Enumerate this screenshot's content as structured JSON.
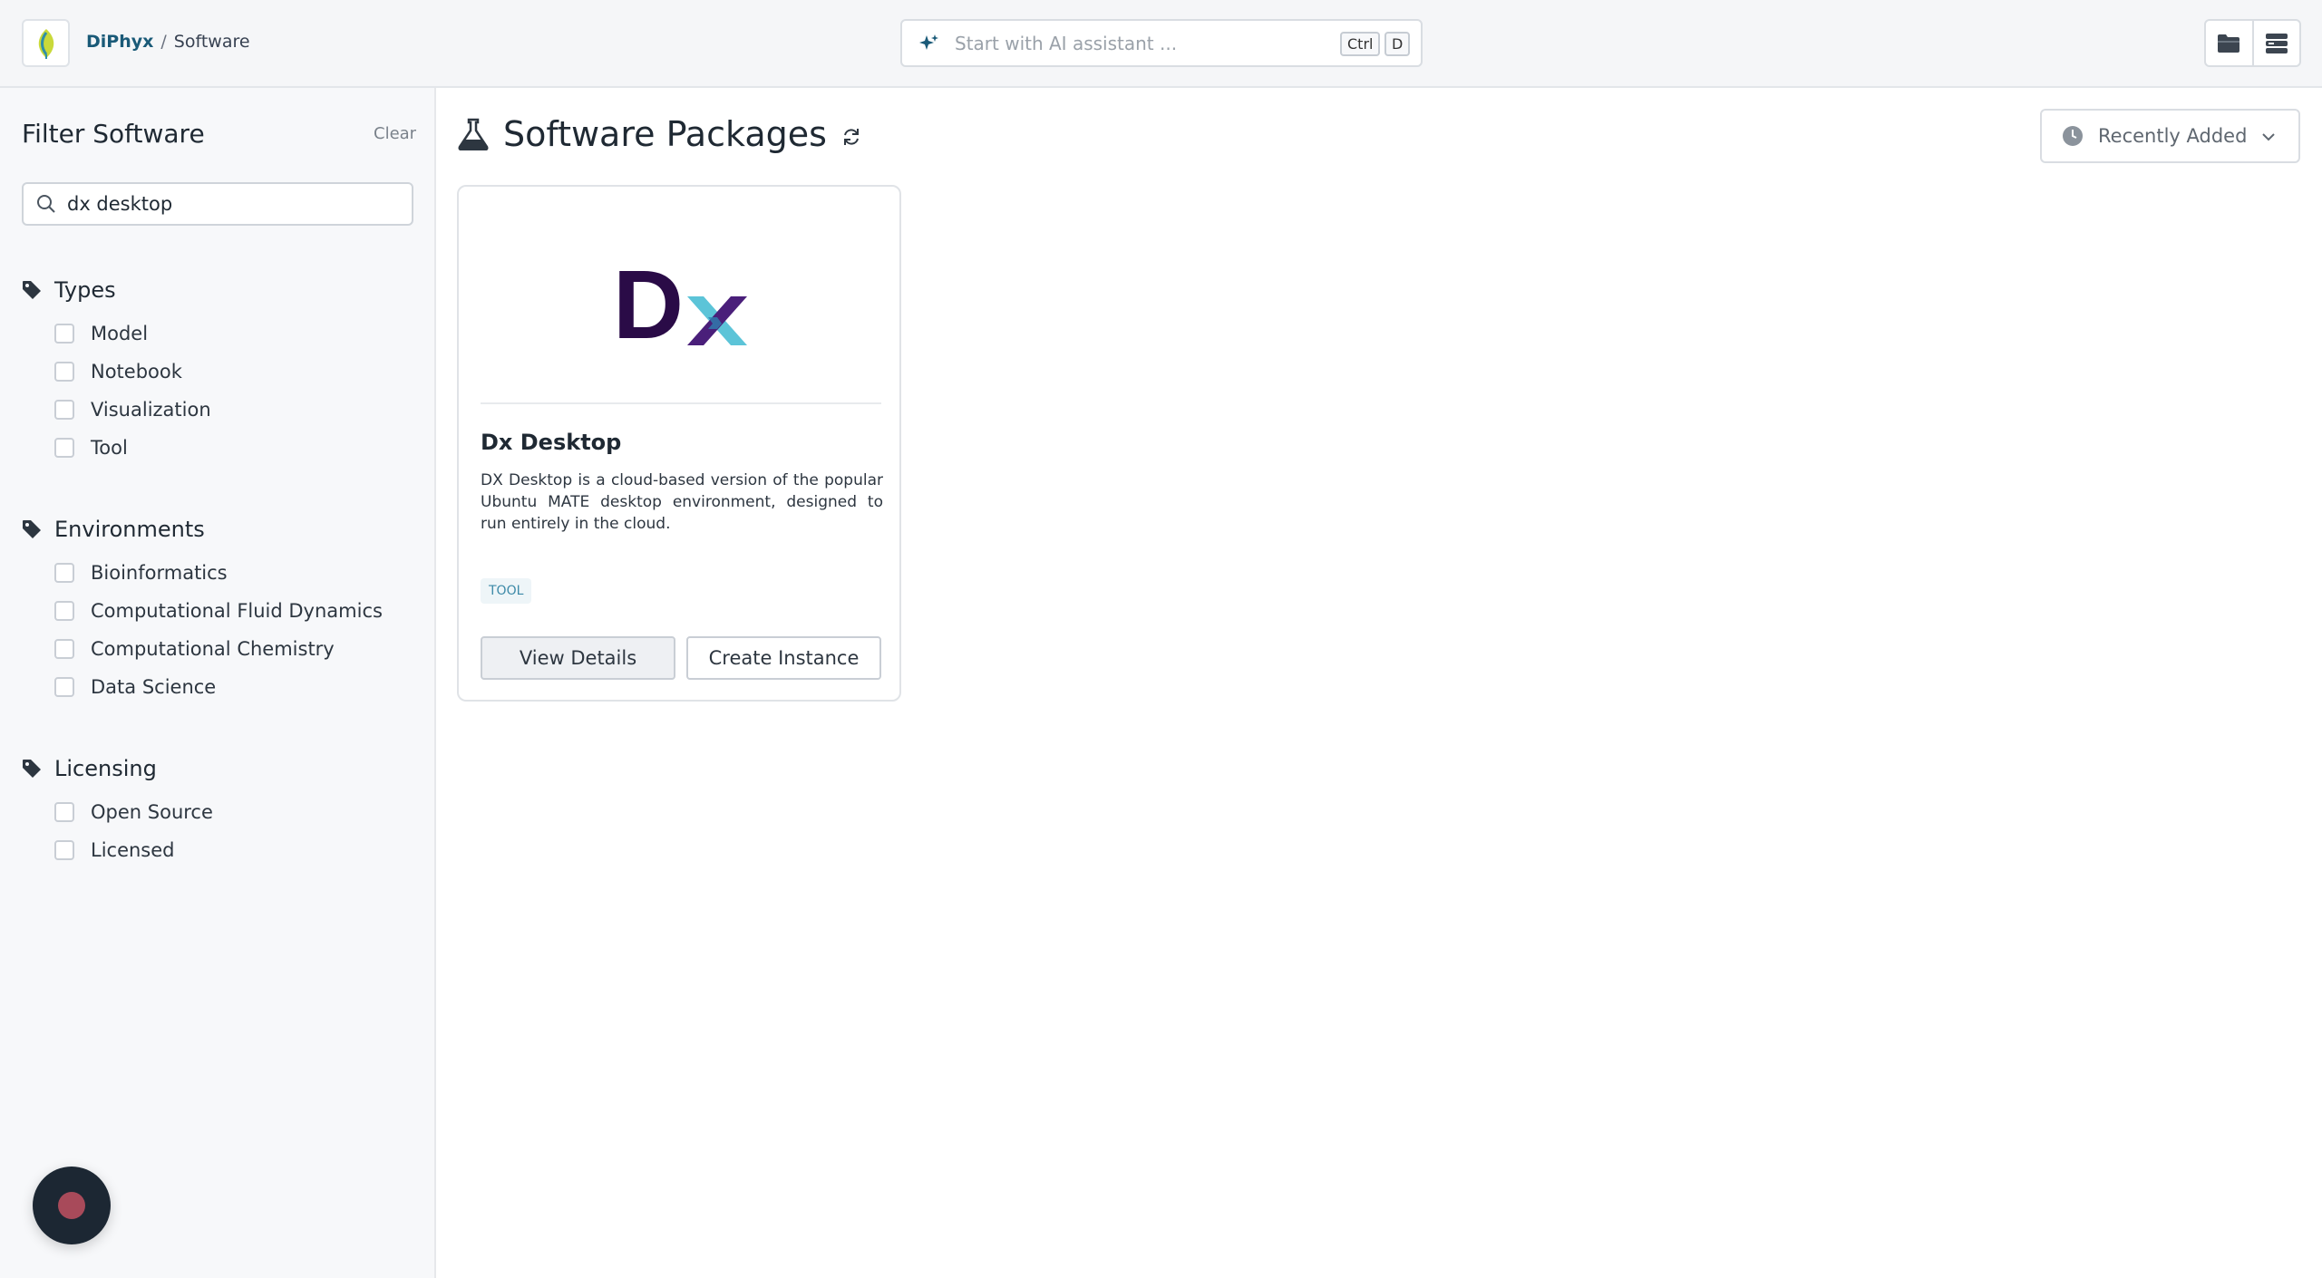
{
  "header": {
    "breadcrumb_root": "DiPhyx",
    "breadcrumb_sep": "/",
    "breadcrumb_current": "Software",
    "ai_placeholder": "Start with AI assistant ...",
    "shortcut_mod": "Ctrl",
    "shortcut_key": "D"
  },
  "sidebar": {
    "title": "Filter Software",
    "clear_label": "Clear",
    "search_value": "dx desktop",
    "sections": [
      {
        "label": "Types",
        "options": [
          "Model",
          "Notebook",
          "Visualization",
          "Tool"
        ]
      },
      {
        "label": "Environments",
        "options": [
          "Bioinformatics",
          "Computational Fluid Dynamics",
          "Computational Chemistry",
          "Data Science"
        ]
      },
      {
        "label": "Licensing",
        "options": [
          "Open Source",
          "Licensed"
        ]
      }
    ]
  },
  "main": {
    "title": "Software Packages",
    "sort_label": "Recently Added",
    "cards": [
      {
        "logo_text": "Dx",
        "title": "Dx Desktop",
        "description": "DX Desktop is a cloud-based version of the popular Ubuntu MATE desktop environment, designed to run entirely in the cloud.",
        "badge": "TOOL",
        "view_label": "View Details",
        "create_label": "Create Instance"
      }
    ]
  },
  "colors": {
    "accent": "#1a5a78",
    "logo_dark": "#2a0b47",
    "logo_light": "#5cc4d8",
    "fab": "#1c2733",
    "fab_dot": "#a84a5a"
  }
}
